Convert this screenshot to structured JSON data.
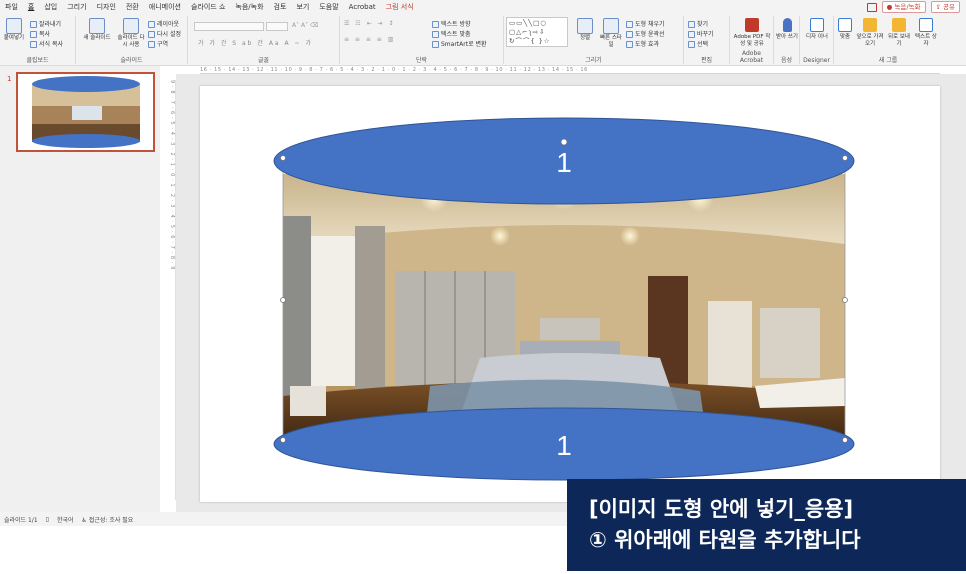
{
  "menu": {
    "tabs": [
      "파일",
      "홈",
      "삽입",
      "그리기",
      "디자인",
      "전환",
      "애니메이션",
      "슬라이드 쇼",
      "녹음/녹화",
      "검토",
      "보기",
      "도움말",
      "Acrobat",
      "그림 서식"
    ],
    "active_tab": "홈",
    "context_tab": "그림 서식",
    "record_button": "녹음/녹화",
    "share_button": "공유"
  },
  "ribbon": {
    "clipboard": {
      "paste": "붙여넣기",
      "cut": "잘라내기",
      "copy": "복사",
      "format_painter": "서식 복사",
      "label": "클립보드"
    },
    "slides": {
      "new_slide": "새 슬라이드",
      "reuse_slides": "슬라이드 다시 사용",
      "layout": "레이아웃",
      "reset": "다시 설정",
      "section": "구역",
      "label": "슬라이드"
    },
    "font": {
      "label": "글꼴"
    },
    "paragraph": {
      "text_direction": "텍스트 방향",
      "align_text": "텍스트 맞춤",
      "smartart": "SmartArt로 변환",
      "label": "단락"
    },
    "drawing": {
      "arrange": "정렬",
      "quick_styles": "빠른 스타일",
      "shape_fill": "도형 채우기",
      "shape_outline": "도형 윤곽선",
      "shape_effects": "도형 효과",
      "label": "그리기"
    },
    "editing": {
      "find": "찾기",
      "replace": "바꾸기",
      "select": "선택",
      "label": "편집"
    },
    "adobe": {
      "create_share": "Adobe PDF 작성 및 공유",
      "label": "Adobe Acrobat"
    },
    "voice": {
      "dictate": "받아 쓰기",
      "label": "음성"
    },
    "designer": {
      "designer": "디자 이너",
      "label": "Designer"
    },
    "new_group": {
      "arrange": "맞춤",
      "bring_forward": "앞으로 가져오기",
      "send_backward": "뒤로 보내기",
      "text_box": "텍스트 상자",
      "label": "새 그룹"
    }
  },
  "ruler": {
    "horizontal": "16 · 15 · 14 · 13 · 12 · 11 · 10 · 9 · 8 · 7 · 6 · 5 · 4 · 3 · 2 · 1 · 0 · 1 · 2 · 3 · 4 · 5 · 6 · 7 · 8 · 9 · 10 · 11 · 12 · 13 · 14 · 15 · 16",
    "vertical": "9 · 8 · 7 · 6 · 5 · 4 · 3 · 2 · 1 · 0 · 1 · 2 · 3 · 4 · 5 · 6 · 7 · 8 · 9"
  },
  "thumbnails": {
    "slide_number": "1"
  },
  "slide": {
    "top_ellipse_label": "1",
    "bottom_ellipse_label": "1",
    "ellipse_color": "#4472c4"
  },
  "status": {
    "slide_info": "슬라이드 1/1",
    "language": "한국어",
    "accessibility": "접근성: 조사 필요"
  },
  "caption": {
    "title": "[이미지 도형 안에 넣기_응용]",
    "subtitle": "① 위아래에 타원을 추가합니다"
  }
}
